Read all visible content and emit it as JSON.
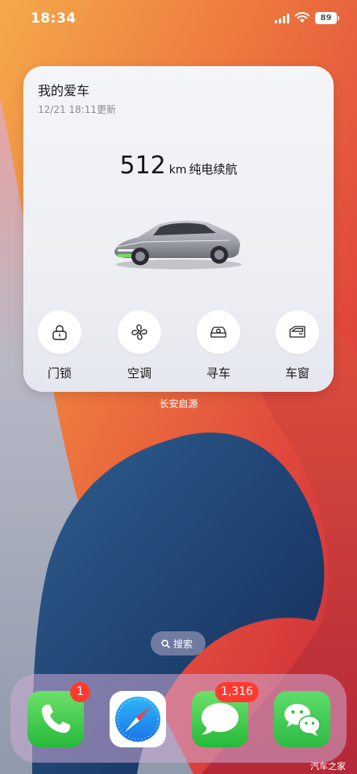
{
  "status_bar": {
    "time": "18:34",
    "battery": "89"
  },
  "widget": {
    "title": "我的爱车",
    "updated": "12/21 18:11更新",
    "range_value": "512",
    "range_unit": "km",
    "range_label": "纯电续航",
    "controls": [
      {
        "label": "门锁",
        "icon": "lock-icon"
      },
      {
        "label": "空调",
        "icon": "fan-icon"
      },
      {
        "label": "寻车",
        "icon": "find-car-icon"
      },
      {
        "label": "车窗",
        "icon": "car-window-icon"
      }
    ],
    "caption": "长安启源"
  },
  "search": {
    "label": "搜索",
    "icon": "search-icon"
  },
  "dock": [
    {
      "name": "phone",
      "icon": "phone-icon",
      "badge": "1"
    },
    {
      "name": "safari",
      "icon": "compass-icon",
      "badge": ""
    },
    {
      "name": "messages",
      "icon": "message-bubble-icon",
      "badge": "1,316"
    },
    {
      "name": "wechat",
      "icon": "wechat-icon",
      "badge": ""
    }
  ],
  "watermark": "汽车之家",
  "colors": {
    "badge": "#ff3b30",
    "accent_green": "#34c759",
    "widget_bg": "#f0f1f5"
  }
}
